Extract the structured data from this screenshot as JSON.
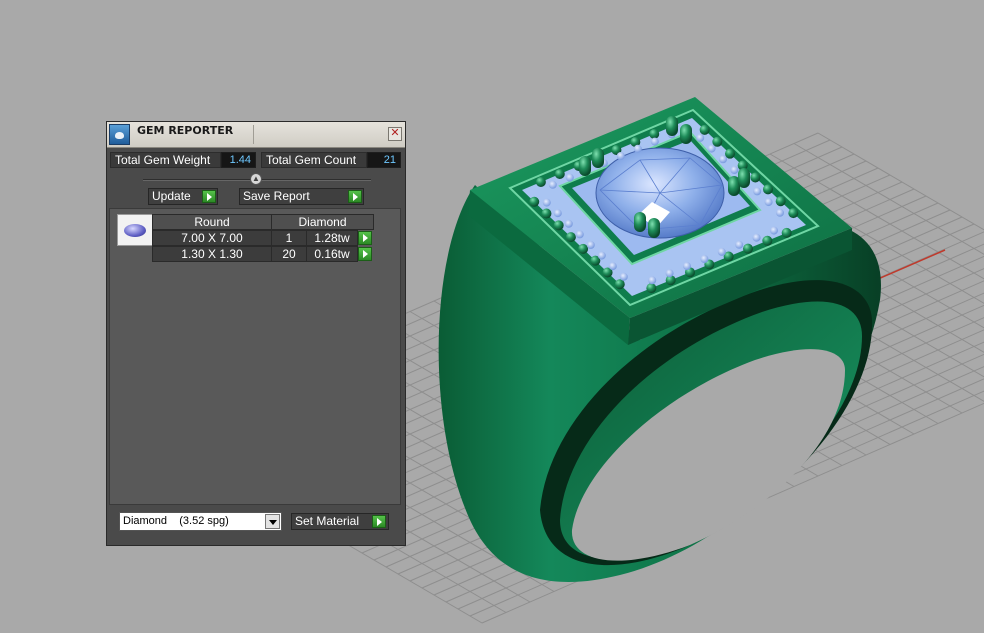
{
  "panel": {
    "title": "GEM REPORTER",
    "close_glyph": "✕",
    "total_weight_label": "Total Gem Weight",
    "total_weight_value": "1.44",
    "total_count_label": "Total Gem Count",
    "total_count_value": "21",
    "update_label": "Update",
    "save_report_label": "Save Report",
    "table": {
      "headers": [
        "Round",
        "Diamond"
      ],
      "rows": [
        {
          "size": "7.00 X 7.00",
          "count": "1",
          "weight": "1.28tw"
        },
        {
          "size": "1.30 X 1.30",
          "count": "20",
          "weight": "0.16tw"
        }
      ]
    },
    "material_select_value": "Diamond    (3.52 spg)",
    "set_material_label": "Set Material"
  },
  "icons": {
    "app": "gem-reporter-icon",
    "close": "close-icon",
    "go": "green-play-arrow-icon",
    "gem": "round-diamond-icon",
    "dropdown": "chevron-down-icon"
  },
  "colors": {
    "viewport_bg": "#a9a9a9",
    "ring_green": "#0f7a4a",
    "gem_blue": "#8fb0ea",
    "value_text": "#6ec8ff",
    "go_button": "#3aa632"
  }
}
